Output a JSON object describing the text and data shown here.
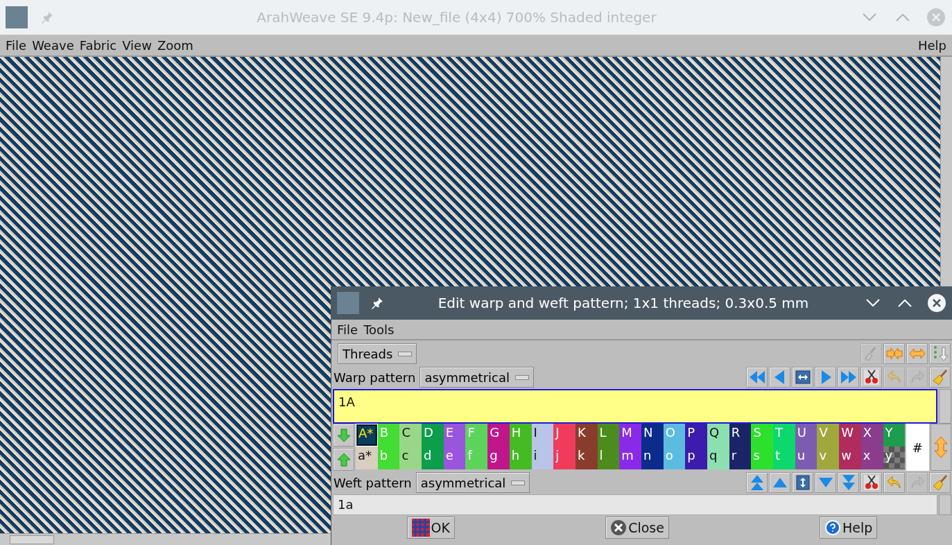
{
  "window": {
    "title": "ArahWeave SE 9.4p: New_file (4x4) 700% Shaded integer"
  },
  "menu": [
    "File",
    "Weave",
    "Fabric",
    "View",
    "Zoom"
  ],
  "help_menu": "Help",
  "dialog": {
    "title": "Edit warp and weft pattern; 1x1 threads; 0.3x0.5 mm",
    "menu": [
      "File",
      "Tools"
    ],
    "mode_select": "Threads",
    "top_tools": [
      {
        "kind": "brush",
        "disabled": true
      },
      {
        "kind": "merge",
        "disabled": false
      },
      {
        "kind": "split",
        "disabled": false
      },
      {
        "kind": "dots-down",
        "disabled": false
      }
    ],
    "warp": {
      "label": "Warp pattern",
      "mode": "asymmetrical",
      "value": "1A",
      "focused": true,
      "tools": [
        {
          "kind": "double-left",
          "disabled": false
        },
        {
          "kind": "left",
          "disabled": false
        },
        {
          "kind": "swap-h",
          "disabled": false
        },
        {
          "kind": "right",
          "disabled": false
        },
        {
          "kind": "double-right",
          "disabled": false
        },
        {
          "kind": "scissors",
          "disabled": false
        },
        {
          "kind": "undo",
          "disabled": true
        },
        {
          "kind": "redo",
          "disabled": true
        },
        {
          "kind": "broom",
          "disabled": false
        }
      ]
    },
    "warp_colors": [
      {
        "label": "A*",
        "color": "#0b3d5c",
        "selected": true,
        "kind": "swatch"
      },
      {
        "label": "B",
        "color": "#44dd33",
        "selected": false,
        "kind": "swatch"
      },
      {
        "label": "C",
        "color": "#99d688",
        "selected": false,
        "kind": "swatch"
      },
      {
        "label": "D",
        "color": "#0c9e4a",
        "selected": false,
        "kind": "swatch"
      },
      {
        "label": "E",
        "color": "#9955dd",
        "selected": false,
        "kind": "swatch"
      },
      {
        "label": "F",
        "color": "#5cd45c",
        "selected": false,
        "kind": "swatch"
      },
      {
        "label": "G",
        "color": "#c0168c",
        "selected": false,
        "kind": "swatch"
      },
      {
        "label": "H",
        "color": "#44bb22",
        "selected": false,
        "kind": "swatch"
      },
      {
        "label": "I",
        "color": "#b8c4e8",
        "selected": false,
        "kind": "swatch"
      },
      {
        "label": "J",
        "color": "#f03c5c",
        "selected": false,
        "kind": "swatch"
      },
      {
        "label": "K",
        "color": "#8a3c2c",
        "selected": false,
        "kind": "swatch"
      },
      {
        "label": "L",
        "color": "#4c8c1c",
        "selected": false,
        "kind": "swatch"
      },
      {
        "label": "M",
        "color": "#8a2ae8",
        "selected": false,
        "kind": "swatch"
      },
      {
        "label": "N",
        "color": "#0c2c8c",
        "selected": false,
        "kind": "swatch"
      },
      {
        "label": "O",
        "color": "#5cbce0",
        "selected": false,
        "kind": "swatch"
      },
      {
        "label": "P",
        "color": "#3c1cac",
        "selected": false,
        "kind": "swatch"
      },
      {
        "label": "Q",
        "color": "#8ce0b0",
        "selected": false,
        "kind": "swatch"
      },
      {
        "label": "R",
        "color": "#1c2468",
        "selected": false,
        "kind": "swatch"
      },
      {
        "label": "S",
        "color": "#2ce02c",
        "selected": false,
        "kind": "swatch"
      },
      {
        "label": "T",
        "color": "#0cd86c",
        "selected": false,
        "kind": "swatch"
      },
      {
        "label": "U",
        "color": "#7c5cb0",
        "selected": false,
        "kind": "swatch"
      },
      {
        "label": "V",
        "color": "#a0a83c",
        "selected": false,
        "kind": "swatch"
      },
      {
        "label": "W",
        "color": "#b02c5c",
        "selected": false,
        "kind": "swatch"
      },
      {
        "label": "X",
        "color": "#8c3c8c",
        "selected": false,
        "kind": "swatch"
      },
      {
        "label": "Y",
        "color": "#1c9c4c",
        "selected": false,
        "kind": "swatch"
      }
    ],
    "weft_colors": [
      {
        "label": "a*",
        "color": "#d8cfc0",
        "selected": false,
        "kind": "swatch"
      },
      {
        "label": "b",
        "color": "#44dd33",
        "selected": false,
        "kind": "swatch"
      },
      {
        "label": "c",
        "color": "#99d688",
        "selected": false,
        "kind": "swatch"
      },
      {
        "label": "d",
        "color": "#0c9e4a",
        "selected": false,
        "kind": "swatch"
      },
      {
        "label": "e",
        "color": "#9955dd",
        "selected": false,
        "kind": "swatch"
      },
      {
        "label": "f",
        "color": "#5cd45c",
        "selected": false,
        "kind": "swatch"
      },
      {
        "label": "g",
        "color": "#c0168c",
        "selected": false,
        "kind": "swatch"
      },
      {
        "label": "h",
        "color": "#44bb22",
        "selected": false,
        "kind": "swatch"
      },
      {
        "label": "i",
        "color": "#b8c4e8",
        "selected": false,
        "kind": "swatch"
      },
      {
        "label": "j",
        "color": "#f03c5c",
        "selected": false,
        "kind": "swatch"
      },
      {
        "label": "k",
        "color": "#8a3c2c",
        "selected": false,
        "kind": "swatch"
      },
      {
        "label": "l",
        "color": "#4c8c1c",
        "selected": false,
        "kind": "swatch"
      },
      {
        "label": "m",
        "color": "#8a2ae8",
        "selected": false,
        "kind": "swatch"
      },
      {
        "label": "n",
        "color": "#0c2c8c",
        "selected": false,
        "kind": "swatch"
      },
      {
        "label": "o",
        "color": "#5cbce0",
        "selected": false,
        "kind": "swatch"
      },
      {
        "label": "p",
        "color": "#3c1cac",
        "selected": false,
        "kind": "swatch"
      },
      {
        "label": "q",
        "color": "#8ce0b0",
        "selected": false,
        "kind": "swatch"
      },
      {
        "label": "r",
        "color": "#1c2468",
        "selected": false,
        "kind": "swatch"
      },
      {
        "label": "s",
        "color": "#2ce02c",
        "selected": false,
        "kind": "swatch"
      },
      {
        "label": "t",
        "color": "#0cd86c",
        "selected": false,
        "kind": "swatch"
      },
      {
        "label": "u",
        "color": "#7c5cb0",
        "selected": false,
        "kind": "swatch"
      },
      {
        "label": "v",
        "color": "#a0a83c",
        "selected": false,
        "kind": "swatch"
      },
      {
        "label": "w",
        "color": "#b02c5c",
        "selected": false,
        "kind": "swatch"
      },
      {
        "label": "x",
        "color": "#8c3c8c",
        "selected": false,
        "kind": "swatch"
      },
      {
        "label": "y",
        "color": "#7a7a7a",
        "selected": false,
        "kind": "transparent"
      }
    ],
    "spare": "#",
    "weft": {
      "label": "Weft pattern",
      "mode": "asymmetrical",
      "value": "1a",
      "focused": false,
      "tools": [
        {
          "kind": "double-up",
          "disabled": false
        },
        {
          "kind": "up",
          "disabled": false
        },
        {
          "kind": "swap-v",
          "disabled": false
        },
        {
          "kind": "down",
          "disabled": false
        },
        {
          "kind": "double-down",
          "disabled": false
        },
        {
          "kind": "scissors",
          "disabled": false
        },
        {
          "kind": "undo",
          "disabled": false
        },
        {
          "kind": "redo",
          "disabled": true
        },
        {
          "kind": "broom",
          "disabled": false
        }
      ]
    },
    "buttons": [
      {
        "kind": "ok",
        "label": "OK"
      },
      {
        "kind": "close",
        "label": "Close"
      },
      {
        "kind": "help",
        "label": "Help"
      }
    ]
  }
}
